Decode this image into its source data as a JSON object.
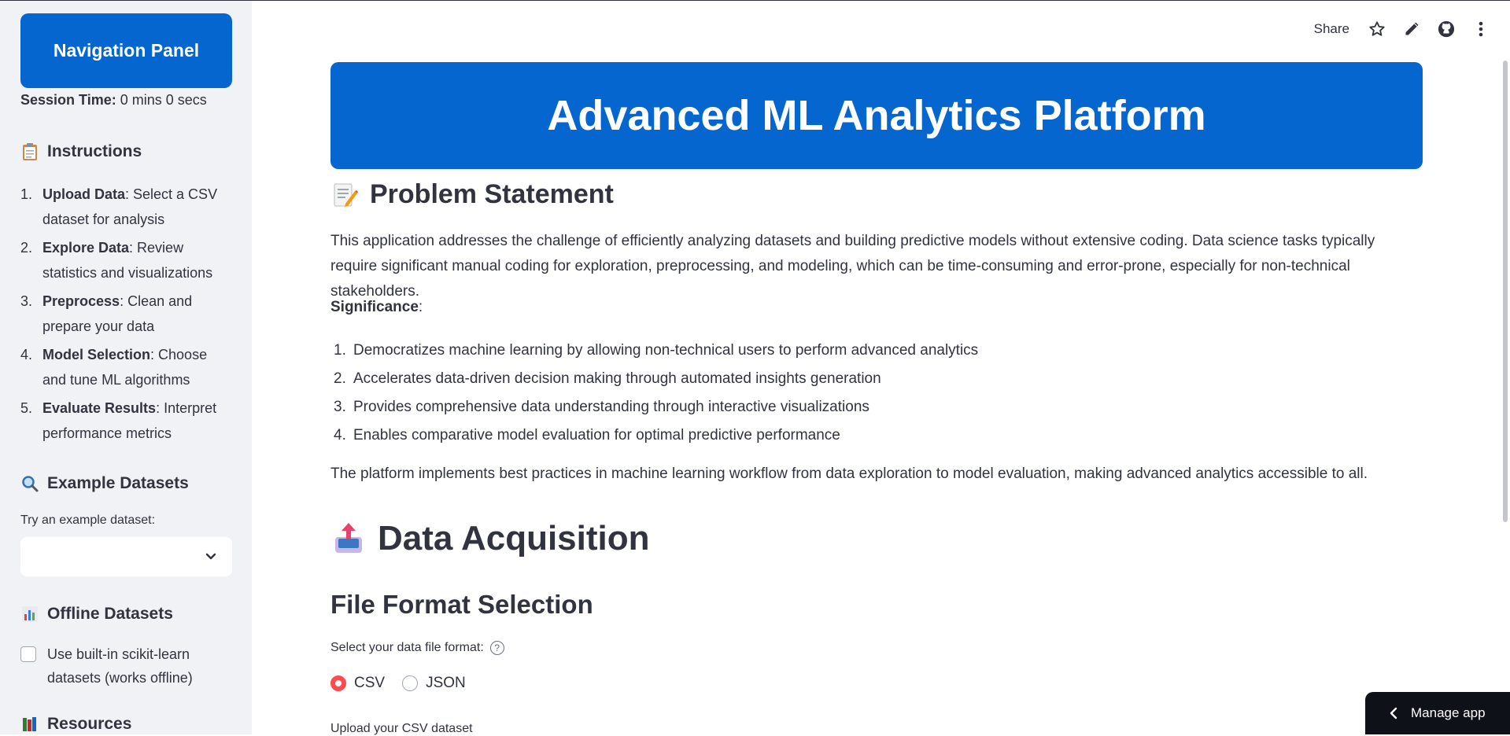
{
  "sidebar": {
    "nav_title": "Navigation Panel",
    "session_label": "Session Time:",
    "session_value": " 0 mins 0 secs",
    "instructions_heading": "Instructions",
    "instructions": [
      {
        "num": "1.",
        "bold": "Upload Data",
        "text": ": Select a CSV dataset for analysis"
      },
      {
        "num": "2.",
        "bold": "Explore Data",
        "text": ": Review statistics and visualizations"
      },
      {
        "num": "3.",
        "bold": "Preprocess",
        "text": ": Clean and prepare your data"
      },
      {
        "num": "4.",
        "bold": "Model Selection",
        "text": ": Choose and tune ML algorithms"
      },
      {
        "num": "5.",
        "bold": "Evaluate Results",
        "text": ": Interpret performance metrics"
      }
    ],
    "examples_heading": "Example Datasets",
    "examples_label": "Try an example dataset:",
    "examples_value": "",
    "offline_heading": "Offline Datasets",
    "offline_checkbox_label": "Use built-in scikit-learn datasets (works offline)",
    "resources_heading": "Resources"
  },
  "toolbar": {
    "share_label": "Share",
    "icons": [
      "star-icon",
      "pencil-icon",
      "github-icon",
      "more-vertical-icon"
    ]
  },
  "main": {
    "banner_title": "Advanced ML Analytics Platform",
    "problem_heading": "Problem Statement",
    "problem_text": "This application addresses the challenge of efficiently analyzing datasets and building predictive models without extensive coding. Data science tasks typically require significant manual coding for exploration, preprocessing, and modeling, which can be time-consuming and error-prone, especially for non-technical stakeholders.",
    "significance_label": "Significance",
    "significance_colon": ":",
    "significance_items": [
      {
        "num": "1.",
        "text": "Democratizes machine learning by allowing non-technical users to perform advanced analytics"
      },
      {
        "num": "2.",
        "text": "Accelerates data-driven decision making through automated insights generation"
      },
      {
        "num": "3.",
        "text": "Provides comprehensive data understanding through interactive visualizations"
      },
      {
        "num": "4.",
        "text": "Enables comparative model evaluation for optimal predictive performance"
      }
    ],
    "platform_text": "The platform implements best practices in machine learning workflow from data exploration to model evaluation, making advanced analytics accessible to all.",
    "acquisition_heading": "Data Acquisition",
    "format_heading": "File Format Selection",
    "format_label": "Select your data file format:",
    "format_help": "?",
    "format_options": [
      "CSV",
      "JSON"
    ],
    "format_selected": "CSV",
    "upload_label": "Upload your CSV dataset"
  },
  "manage_app_label": "Manage app",
  "colors": {
    "accent_blue": "#0566d0",
    "radio_red": "#ff4b4b",
    "sidebar_bg": "#f0f2f6"
  }
}
